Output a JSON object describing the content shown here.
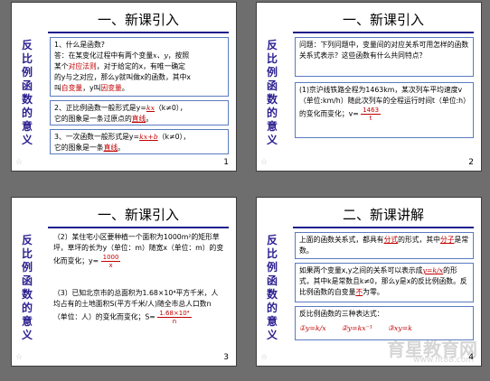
{
  "side_title": "反比例函数的意义",
  "slide1": {
    "title": "一、新课引入",
    "box1": {
      "line1": "1、什么是函数?",
      "line2a": "答：在某变化过程中有两个变量",
      "vars": "x、y",
      "line2b": "，按照",
      "line3a": "某个",
      "line3red": "对应法则",
      "line3b": "，对于给定的x，有唯一确定",
      "line4a": "的y与之对应，那么y就叫做x的函数，其中x",
      "line5a": "叫",
      "line5red": "自变量",
      "line5b": "，y叫",
      "line5red2": "因变量",
      "line5c": "。"
    },
    "box2": {
      "text1": "2、正比例函数一般形式是y=",
      "formula": "kx",
      "text2": "（k≠0），",
      "text3": "它的图象是一条过原点的",
      "red": "直线",
      "text4": "。"
    },
    "box3": {
      "text1": "3、一次函数一般形式是y=",
      "formula": "kx+b",
      "text2": "（k≠0），",
      "text3": "它的图象是一条",
      "red": "直线",
      "text4": "。"
    },
    "number": "1"
  },
  "slide2": {
    "title": "一、新课引入",
    "box1": "问题：下列问题中，变量间的对应关系可用怎样的函数关系式表示？这些函数有什么共同特点？",
    "box2": {
      "text": "(1)京沪线铁路全程为1463km，某次列车平均速度v（单位:km/h）随此次列车的全程运行时间t（单位:h）的变化而变化；v=",
      "num": "1463",
      "den": "t"
    },
    "number": "2"
  },
  "slide3": {
    "title": "一、新课引入",
    "p1": {
      "text": "（2）某住宅小区要种植一个面积为1000m²的矩形草坪，草坪的长为y（单位：m）随宽x（单位：m）的变化而变化；y=",
      "num": "1000",
      "den": "x"
    },
    "p2": {
      "text": "（3）已知北京市的总面积为1.68×10⁴平方千米，人均占有的土地面积S(平方千米/人)随全市总人口数n（单位：人）的变化而变化；S=",
      "num": "1.68×10⁴",
      "den": "n"
    },
    "number": "3"
  },
  "slide4": {
    "title": "二、新课讲解",
    "box1": {
      "text1": "上面的函数关系式，都具有",
      "red1": "分式",
      "text2": "的形式，其中",
      "red2": "分子",
      "text3": "是常数。"
    },
    "box2": {
      "text1": "如果两个变量x,y之间的关系可以表示成",
      "formula": "y=k/x",
      "text2": "的形式，其中k是常数且k≠0，那么y是x的反比例函数。反比例函数的自变量",
      "red": "不",
      "text3": "为零。"
    },
    "box3": {
      "heading": "反比例函数的三种表达式：",
      "f1": "①y=k/x",
      "f2": "②y=kx⁻¹",
      "f3": "③xy=k"
    },
    "number": "4",
    "watermark": "育星教育网",
    "watermark_sub": "www.ht88.com"
  }
}
